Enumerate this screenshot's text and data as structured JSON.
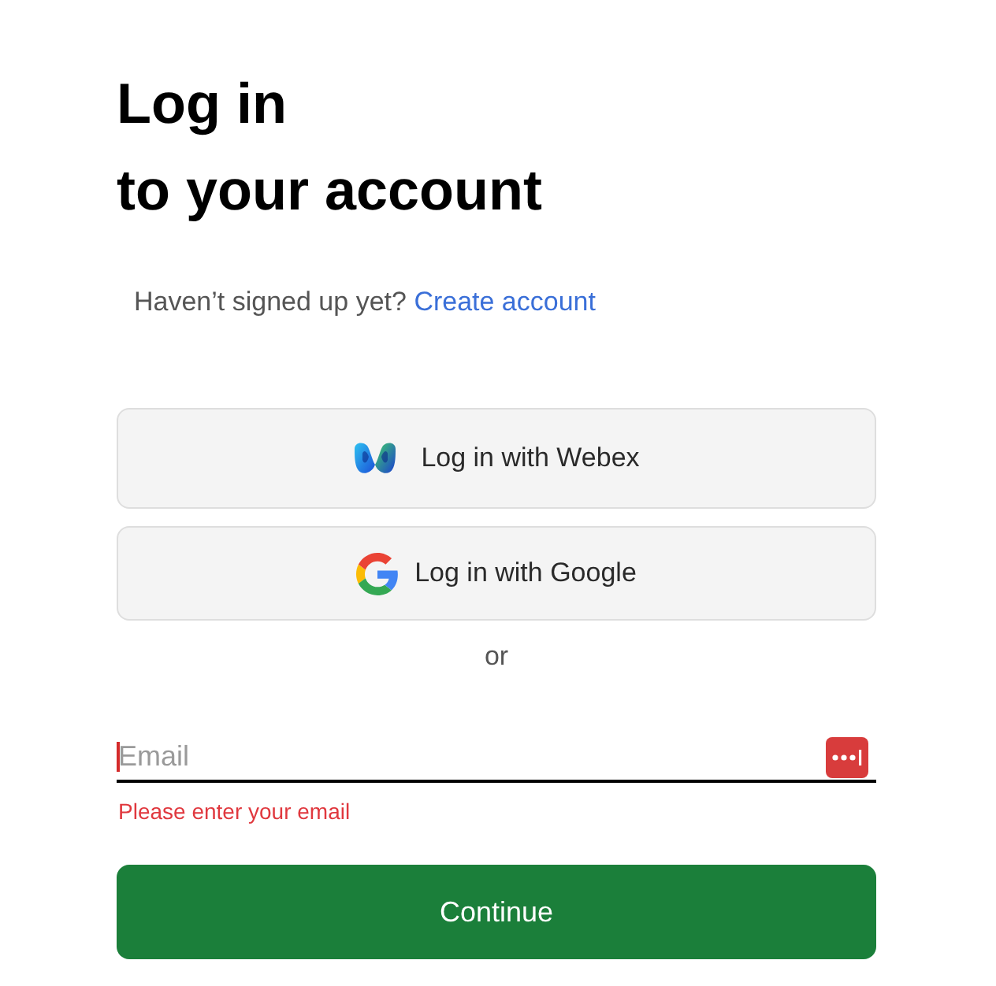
{
  "title_lines": [
    "Log in",
    "to your account"
  ],
  "signup_prompt": {
    "text": "Haven’t signed up yet?",
    "link": "Create account"
  },
  "sso_buttons": [
    {
      "kind": "webex",
      "label": "Log in with Webex"
    },
    {
      "kind": "google",
      "label": "Log in with Google"
    }
  ],
  "divider_text": "or",
  "email_field": {
    "placeholder": "Email",
    "focused": true,
    "error": "Please enter your email"
  },
  "continue_button": {
    "label": "Continue"
  }
}
